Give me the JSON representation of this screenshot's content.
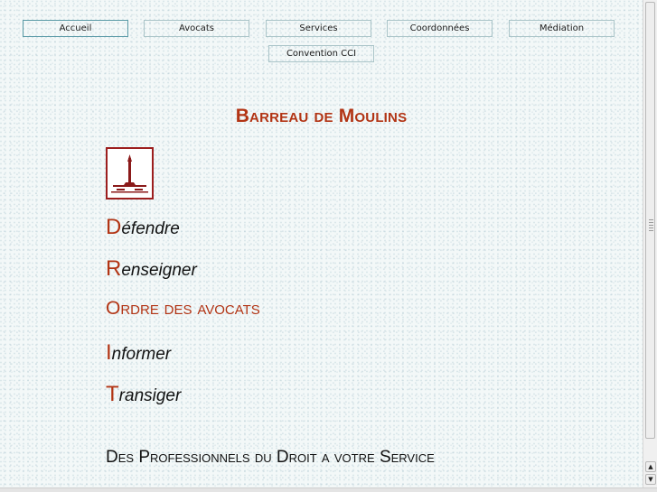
{
  "nav": {
    "row1": [
      {
        "label": "Accueil",
        "active": true
      },
      {
        "label": "Avocats",
        "active": false
      },
      {
        "label": "Services",
        "active": false
      },
      {
        "label": "Coordonnées",
        "active": false
      },
      {
        "label": "Médiation",
        "active": false
      }
    ],
    "row2": [
      {
        "label": "Convention CCI",
        "active": false
      }
    ]
  },
  "header": {
    "title": "Barreau de Moulins"
  },
  "logo": {
    "icon": "scales-of-justice-icon",
    "border_color": "#9c1e1e"
  },
  "acrostic": {
    "d": {
      "cap": "D",
      "rest": "éfendre"
    },
    "r": {
      "cap": "R",
      "rest": "enseigner"
    },
    "o": {
      "text": "Ordre des avocats"
    },
    "i": {
      "cap": "I",
      "rest": "nformer"
    },
    "t": {
      "cap": "T",
      "rest": "ransiger"
    }
  },
  "tagline": "Des Professionnels du Droit a votre Service",
  "colors": {
    "accent": "#b23414",
    "text": "#111111",
    "nav_border": "#aac4c8"
  },
  "scrollbar": {
    "up_arrow": "▲",
    "down_arrow": "▼"
  }
}
